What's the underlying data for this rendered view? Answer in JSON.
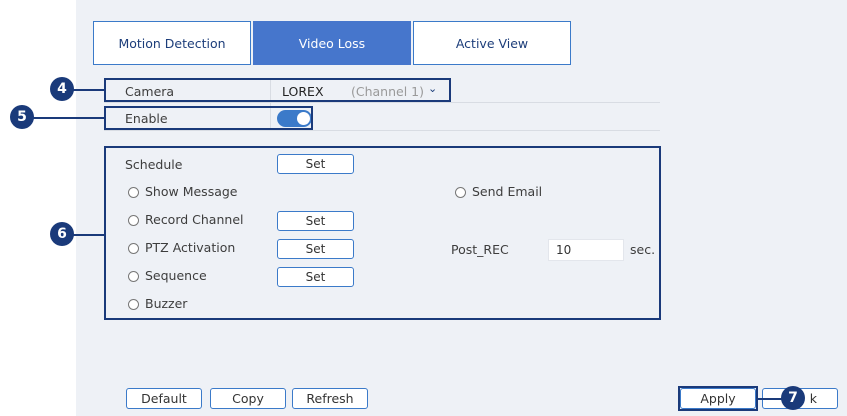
{
  "tabs": [
    {
      "label": "Motion Detection",
      "active": false
    },
    {
      "label": "Video Loss",
      "active": true
    },
    {
      "label": "Active View",
      "active": false
    }
  ],
  "camera": {
    "label": "Camera",
    "value": "LOREX",
    "channel": "(Channel 1)"
  },
  "enable": {
    "label": "Enable",
    "on": true
  },
  "schedule": {
    "label": "Schedule",
    "button": "Set"
  },
  "options": {
    "show_message": "Show Message",
    "send_email": "Send Email",
    "record_channel": "Record Channel",
    "ptz_activation": "PTZ Activation",
    "sequence": "Sequence",
    "buzzer": "Buzzer",
    "set_label": "Set"
  },
  "post_rec": {
    "label": "Post_REC",
    "value": "10",
    "unit": "sec."
  },
  "buttons": {
    "default": "Default",
    "copy": "Copy",
    "refresh": "Refresh",
    "apply": "Apply",
    "back_partial": "k"
  },
  "callouts": {
    "c4": "4",
    "c5": "5",
    "c6": "6",
    "c7": "7"
  },
  "colors": {
    "accent": "#4676cc",
    "callout": "#1a3a7a",
    "panel_bg": "#eef1f6"
  }
}
